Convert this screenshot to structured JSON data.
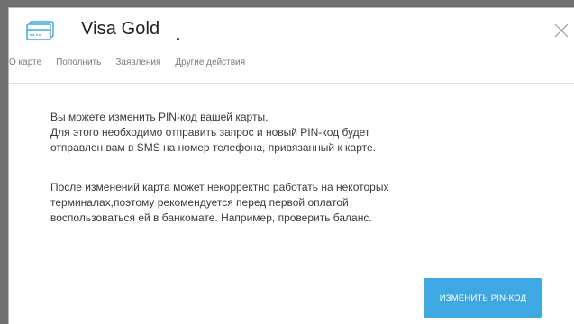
{
  "header": {
    "title": "Visa Gold",
    "icons": {
      "card": "card-icon",
      "close": "close-icon"
    }
  },
  "tabs": [
    {
      "label": "О карте"
    },
    {
      "label": "Пополнить"
    },
    {
      "label": "Заявления"
    },
    {
      "label": "Другие действия"
    }
  ],
  "content": {
    "paragraph1": [
      "Вы можете изменить PIN-код вашей карты.",
      "Для этого необходимо отправить запрос и новый PIN-код будет",
      "отправлен вам в SMS на номер телефона, привязанный к карте."
    ],
    "paragraph2": [
      "После изменений карта может некорректно работать на некоторых",
      "терминалах,поэтому рекомендуется перед первой оплатой",
      "воспользоваться ей в банкомате. Например, проверить баланс."
    ]
  },
  "actions": {
    "primary_label": "ИЗМЕНИТЬ PIN-КОД"
  },
  "colors": {
    "accent": "#3ea8e2",
    "icon": "#3ea8e2"
  }
}
